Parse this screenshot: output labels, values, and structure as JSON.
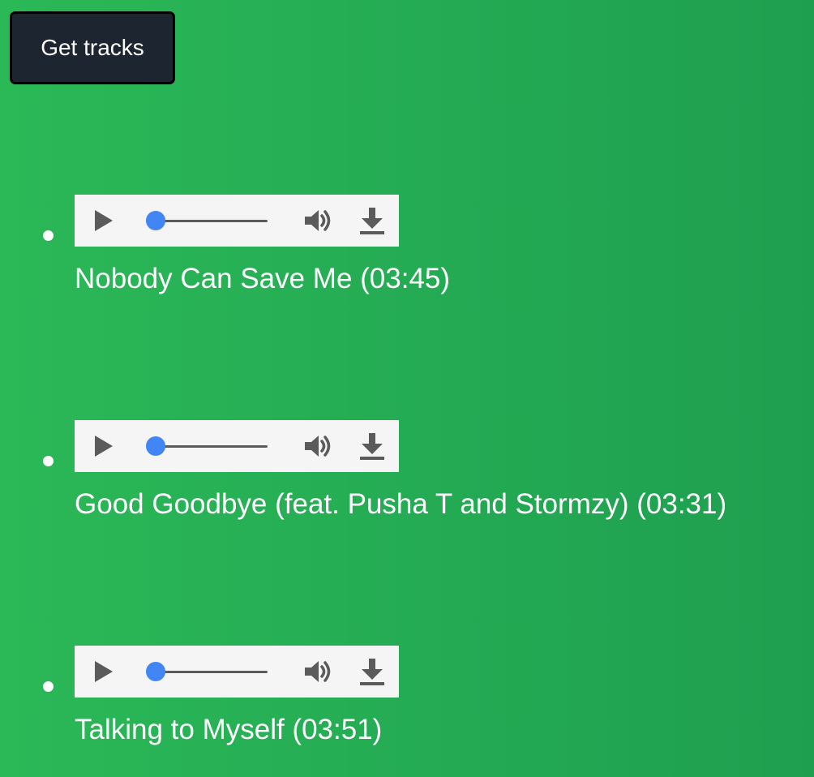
{
  "get_button": {
    "label": "Get tracks"
  },
  "colors": {
    "background_left": "#2bb857",
    "background_right": "#1e9f50",
    "button_bg": "#1d2530",
    "player_bg": "#f5f5f5",
    "progress_knob": "#4285f4",
    "icon_gray": "#5b5b5b"
  },
  "player_icons": [
    "play-icon",
    "progress-slider",
    "volume-icon",
    "download-icon"
  ],
  "tracks": [
    {
      "title": "Nobody Can Save Me (03:45)",
      "progress": 0
    },
    {
      "title": "Good Goodbye (feat. Pusha T and Stormzy) (03:31)",
      "progress": 0
    },
    {
      "title": "Talking to Myself (03:51)",
      "progress": 0
    }
  ]
}
